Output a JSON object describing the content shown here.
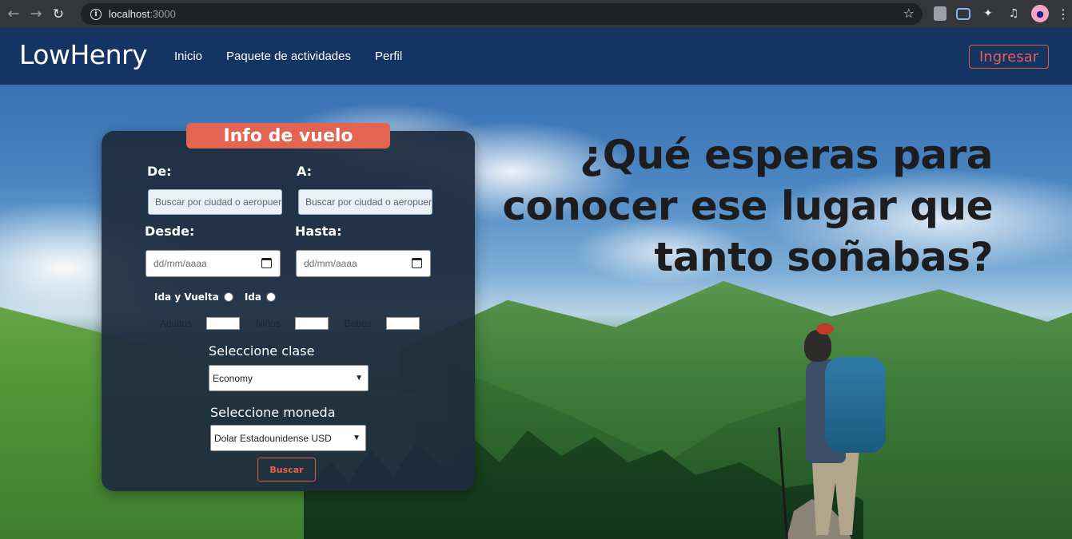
{
  "browser": {
    "url_host": "localhost",
    "url_port": ":3000"
  },
  "navbar": {
    "brand": "LowHenry",
    "links": [
      "Inicio",
      "Paquete de actividades",
      "Perfil"
    ],
    "login_label": "Ingresar"
  },
  "hero": {
    "headline_lines": [
      "¿Qué esperas para",
      "conocer ese lugar que",
      "tanto soñabas?"
    ]
  },
  "flight_form": {
    "title": "Info de vuelo",
    "from_label": "De:",
    "to_label": "A:",
    "from_placeholder": "Buscar por ciudad o aeropuerto",
    "to_placeholder": "Buscar por ciudad o aeropuerto",
    "depart_label": "Desde:",
    "return_label": "Hasta:",
    "date_placeholder": "dd/mm/aaaa",
    "trip_types": [
      "Ida y Vuelta",
      "Ida"
    ],
    "passengers": [
      "Adultos",
      "Niños",
      "Bebes"
    ],
    "class_label": "Seleccione clase",
    "class_value": "Economy",
    "currency_label": "Seleccione moneda",
    "currency_value": "Dolar Estadounidense USD",
    "search_label": "Buscar"
  },
  "colors": {
    "navbar": "#143464",
    "accent": "#e36451",
    "card": "#1d2b3e"
  }
}
